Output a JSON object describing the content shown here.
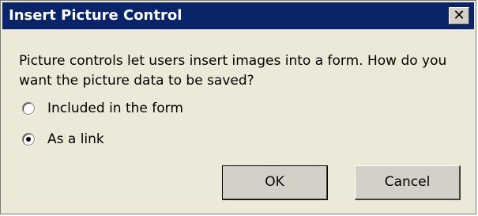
{
  "dialog": {
    "title": "Insert Picture Control",
    "close_glyph": "✕",
    "message": "Picture controls let users insert images into a form. How do you want the picture data to be saved?",
    "options": [
      {
        "label": "Included in the form",
        "selected": false
      },
      {
        "label": "As a link",
        "selected": true
      }
    ],
    "buttons": {
      "ok_label": "OK",
      "cancel_label": "Cancel"
    }
  },
  "colors": {
    "titlebar": "#0a246a",
    "dialog_bg": "#ece9d8",
    "button_bg": "#d4d0c8"
  },
  "icons": {
    "close": "close-icon"
  }
}
